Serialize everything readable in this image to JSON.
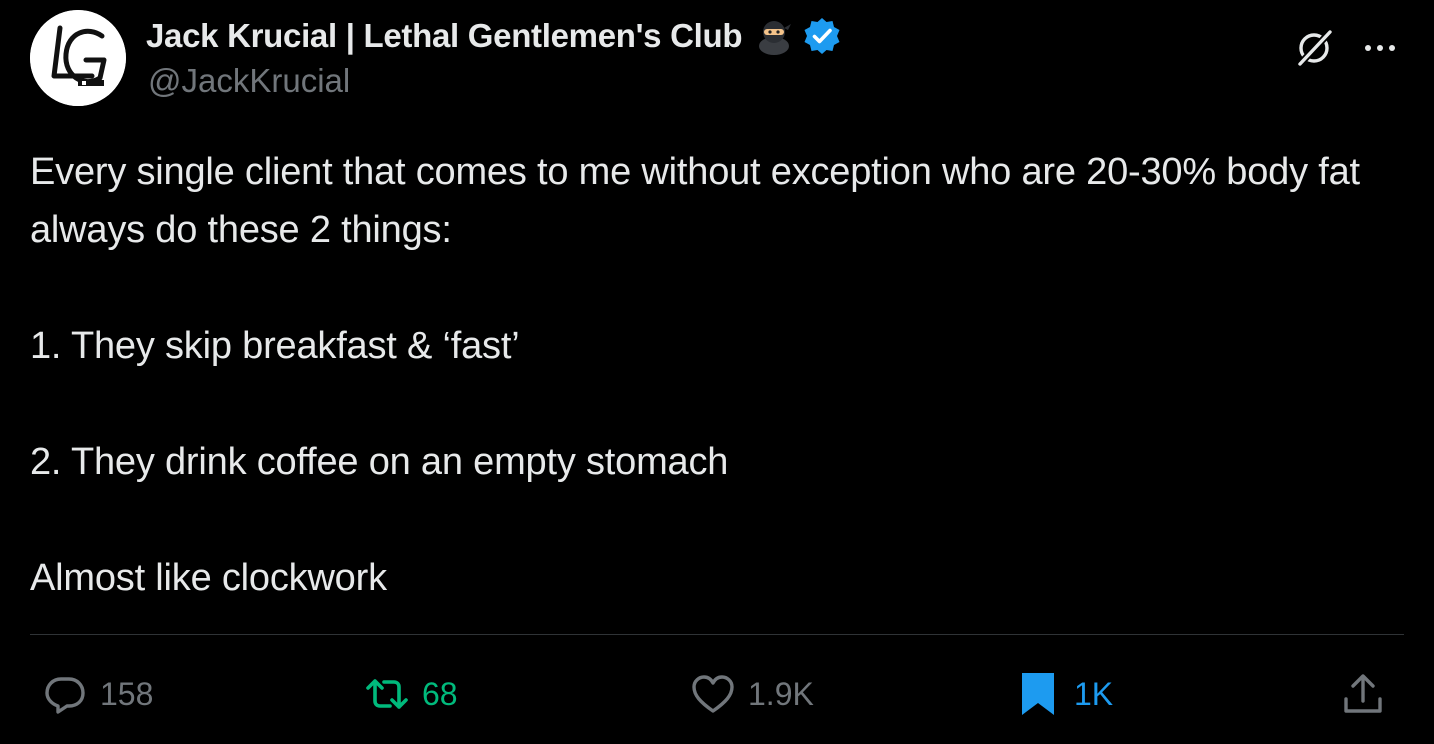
{
  "author": {
    "display_name": "Jack Krucial | Lethal Gentlemen's Club",
    "handle": "@JackKrucial",
    "avatar_logo_text": "LG",
    "name_emoji": "ninja-emoji",
    "verified_icon": "verified-badge-icon",
    "verified_color": "#1d9bf0"
  },
  "header_actions": {
    "grok_icon": "grok-icon",
    "more_icon": "more-icon"
  },
  "tweet": {
    "paragraphs": [
      "Every single client that comes to me without exception who are 20-30% body fat always do these 2 things:",
      "1. They skip breakfast & ‘fast’",
      "2. They drink coffee on an empty stomach",
      "Almost like clockwork"
    ]
  },
  "actions": {
    "reply": {
      "icon": "reply-icon",
      "count": "158",
      "color": "#71767b"
    },
    "retweet": {
      "icon": "retweet-icon",
      "count": "68",
      "color": "#00ba7c"
    },
    "like": {
      "icon": "heart-icon",
      "count": "1.9K",
      "color": "#71767b"
    },
    "bookmark": {
      "icon": "bookmark-icon",
      "count": "1K",
      "color": "#1d9bf0"
    },
    "share": {
      "icon": "share-icon"
    }
  },
  "colors": {
    "background": "#000000",
    "text_primary": "#e7e9ea",
    "text_secondary": "#71767b",
    "divider": "#2f3336"
  }
}
